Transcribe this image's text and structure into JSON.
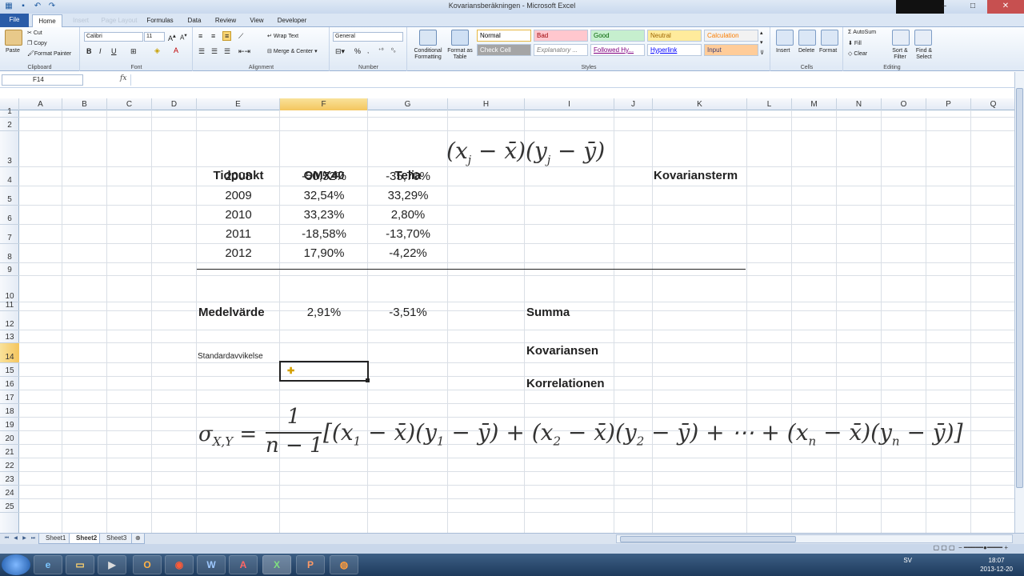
{
  "window": {
    "title": "Kovariansberäkningen - Microsoft Excel"
  },
  "tabs": [
    {
      "label": "File"
    },
    {
      "label": "Home"
    },
    {
      "label": "Insert"
    },
    {
      "label": "Page Layout"
    },
    {
      "label": "Formulas"
    },
    {
      "label": "Data"
    },
    {
      "label": "Review"
    },
    {
      "label": "View"
    },
    {
      "label": "Developer"
    }
  ],
  "ribbon": {
    "clipboard": {
      "label": "Clipboard",
      "paste": "Paste",
      "cut": "Cut",
      "copy": "Copy",
      "format_painter": "Format Painter"
    },
    "font": {
      "label": "Font",
      "name": "Calibri",
      "size": "11",
      "bold": "B",
      "italic": "I",
      "underline": "U"
    },
    "alignment": {
      "label": "Alignment",
      "wrap_text": "Wrap Text",
      "merge_center": "Merge & Center"
    },
    "number": {
      "label": "Number",
      "format": "General",
      "percent": "%"
    },
    "styles": {
      "label": "Styles",
      "conditional": "Conditional Formatting",
      "format_table": "Format as Table",
      "items": [
        {
          "label": "Normal",
          "bg": "#ffffff",
          "fg": "#000000"
        },
        {
          "label": "Bad",
          "bg": "#ffc7ce",
          "fg": "#9c0006"
        },
        {
          "label": "Good",
          "bg": "#c6efce",
          "fg": "#006100"
        },
        {
          "label": "Neutral",
          "bg": "#ffeb9c",
          "fg": "#9c6500"
        },
        {
          "label": "Calculation",
          "bg": "#f2f2f2",
          "fg": "#fa7d00"
        },
        {
          "label": "Check Cell",
          "bg": "#a5a5a5",
          "fg": "#ffffff"
        },
        {
          "label": "Explanatory ...",
          "bg": "#ffffff",
          "fg": "#7f7f7f"
        },
        {
          "label": "Followed Hy...",
          "bg": "#ffffff",
          "fg": "#800080"
        },
        {
          "label": "Hyperlink",
          "bg": "#ffffff",
          "fg": "#0000ff"
        },
        {
          "label": "Input",
          "bg": "#ffcc99",
          "fg": "#3f3f76"
        }
      ]
    },
    "cells": {
      "label": "Cells",
      "insert": "Insert",
      "delete": "Delete",
      "format": "Format"
    },
    "editing": {
      "label": "Editing",
      "autosum": "AutoSum",
      "fill": "Fill",
      "clear": "Clear",
      "sort_filter": "Sort & Filter",
      "find_select": "Find & Select"
    }
  },
  "formula_bar": {
    "name_box": "F14",
    "fx": "fx",
    "content": ""
  },
  "columns": [
    "A",
    "B",
    "C",
    "D",
    "E",
    "F",
    "G",
    "H",
    "I",
    "J",
    "K",
    "L",
    "M",
    "N",
    "O",
    "P",
    "Q"
  ],
  "selected_column": "F",
  "rows": [
    "1",
    "2",
    "3",
    "4",
    "5",
    "6",
    "7",
    "8",
    "9",
    "10",
    "11",
    "12",
    "13",
    "14",
    "15",
    "16",
    "17",
    "18",
    "19",
    "20",
    "21",
    "22",
    "23",
    "24",
    "25"
  ],
  "selected_row": "14",
  "sheet": {
    "headers": {
      "tidpunkt": "Tidpunkt",
      "omx40": "OMX40",
      "telia": "Telia",
      "kovariansterm": "Kovariansterm"
    },
    "data": [
      {
        "year": "2008",
        "omx": "-50,52%",
        "telia": "-35,70%"
      },
      {
        "year": "2009",
        "omx": "32,54%",
        "telia": "33,29%"
      },
      {
        "year": "2010",
        "omx": "33,23%",
        "telia": "2,80%"
      },
      {
        "year": "2011",
        "omx": "-18,58%",
        "telia": "-13,70%"
      },
      {
        "year": "2012",
        "omx": "17,90%",
        "telia": "-4,22%"
      }
    ],
    "medelvarde_label": "Medelvärde",
    "medel_omx": "2,91%",
    "medel_telia": "-3,51%",
    "summa": "Summa",
    "standardavvikelse": "Standardavvikelse",
    "kovariansen": "Kovariansen",
    "korrelationen": "Korrelationen"
  },
  "sheet_tabs": [
    {
      "label": "Sheet1"
    },
    {
      "label": "Sheet2"
    },
    {
      "label": "Sheet3"
    }
  ],
  "active_sheet": "Sheet2",
  "taskbar": {
    "lang": "SV",
    "time": "18:07",
    "date": "2013-12-20"
  }
}
